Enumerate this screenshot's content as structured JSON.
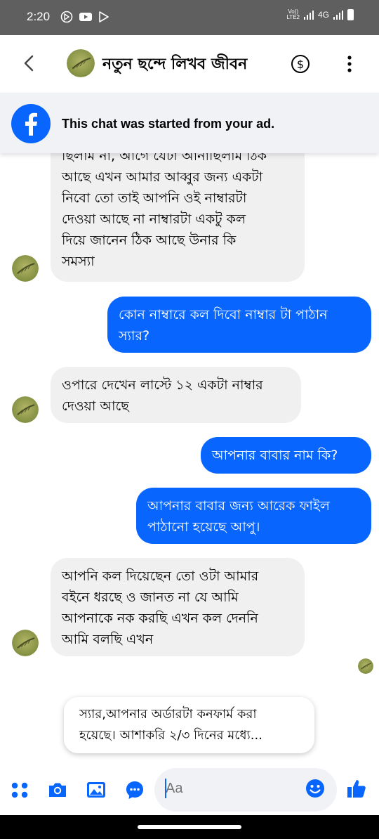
{
  "status_bar": {
    "time": "2:20",
    "network": "4G",
    "volte": "Vo))\nLTE2"
  },
  "header": {
    "title": "নতুন ছন্দে লিখব জীবন"
  },
  "ad_banner": {
    "text": "This chat was started from your ad."
  },
  "messages": [
    {
      "side": "in",
      "text": "ছিলাম না, আগে যেটা আনাছিলাম ঠিক\nআছে এখন আমার আব্বুর জন্য একটা\nনিবো তো তাই আপনি ওই নাম্বারটা\nদেওয়া আছে না নাম্বারটা একটু কল\nদিয়ে জানেন ঠিক আছে উনার কি\nসমস্যা"
    },
    {
      "side": "out",
      "text": "কোন নাম্বারে কল দিবো নাম্বার টা পাঠান\nস্যার?"
    },
    {
      "side": "in",
      "text": "ওপারে দেখেন লাস্টে ১২ একটা নাম্বার\nদেওয়া আছে"
    },
    {
      "side": "out",
      "text": "আপনার বাবার নাম কি?"
    },
    {
      "side": "out",
      "text": "আপনার বাবার জন্য আরেক ফাইল\nপাঠানো হয়েছে আপু।"
    },
    {
      "side": "in",
      "text": "আপনি কল দিয়েছেন তো ওটা আমার\nবইনে ধরছে ও জানত না যে আমি\nআপনাকে নক করছি এখন কল দেননি\nআমি বলছি এখন"
    }
  ],
  "pinned_card": {
    "text": "স্যার,আপনার অর্ডারটা কনফার্ম করা\nহয়েছে। আশাকরি ২/৩ দিনের মধ্যে..."
  },
  "composer": {
    "placeholder": "Aa"
  },
  "colors": {
    "accent": "#0866ff",
    "incoming_bubble": "#f0f0f0",
    "status_bar": "#5f5f5f"
  }
}
